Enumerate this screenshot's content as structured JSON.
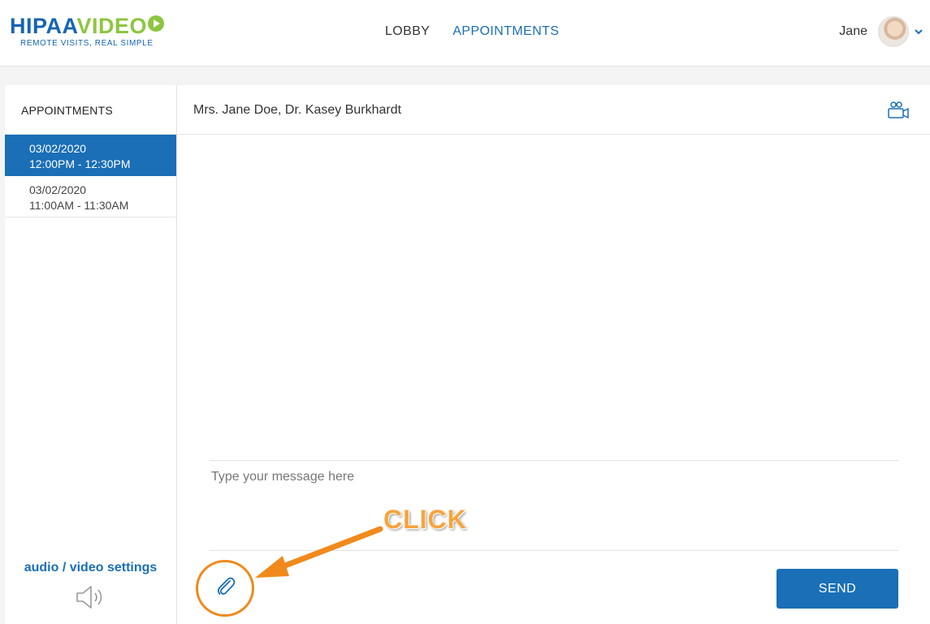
{
  "brand": {
    "logo_part1": "HIPAA",
    "logo_part2": "VIDEO",
    "tagline": "REMOTE VISITS, REAL SIMPLE"
  },
  "nav": {
    "lobby": "LOBBY",
    "appointments": "APPOINTMENTS",
    "active": "APPOINTMENTS"
  },
  "user": {
    "name": "Jane"
  },
  "sidebar": {
    "title": "APPOINTMENTS",
    "appointments": [
      {
        "date": "03/02/2020",
        "time": "12:00PM - 12:30PM",
        "selected": true
      },
      {
        "date": "03/02/2020",
        "time": "11:00AM - 11:30AM",
        "selected": false
      }
    ],
    "av_settings_label": "audio / video settings"
  },
  "chat": {
    "participants": "Mrs. Jane Doe, Dr. Kasey Burkhardt",
    "message_placeholder": "Type your message here",
    "message_value": "",
    "send_label": "SEND"
  },
  "annotation": {
    "text": "CLICK"
  },
  "colors": {
    "primary": "#1a6fb7",
    "logo_green": "#8cc63f",
    "annotation_orange": "#f08a1c"
  }
}
